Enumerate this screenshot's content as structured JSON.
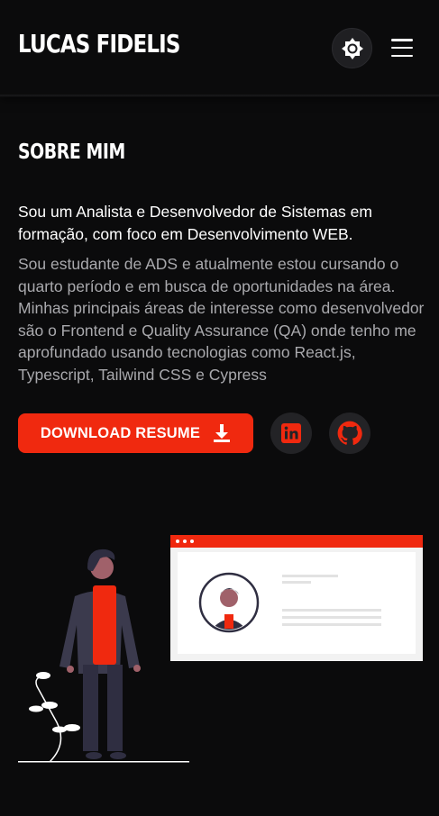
{
  "header": {
    "brand": "LUCAS FIDELIS",
    "theme_toggle_icon": "sun-gear-icon",
    "menu_icon": "hamburger-menu-icon"
  },
  "about": {
    "title": "SOBRE MIM",
    "lead": "Sou um Analista e Desenvolvedor de Sistemas em formação, com foco em Desenvolvimento WEB.",
    "description": "Sou estudante de ADS e atualmente estou cursando o quarto período e em busca de oportunidades na área. Minhas principais áreas de interesse como desenvolvedor são o Frontend e Quality Assurance (QA) onde tenho me aprofundado usando tecnologias como React.js, Typescript, Tailwind CSS e Cypress"
  },
  "actions": {
    "download_label": "DOWNLOAD RESUME",
    "download_icon": "download-icon",
    "linkedin_icon": "linkedin-icon",
    "github_icon": "github-icon"
  },
  "colors": {
    "accent": "#f0290f",
    "background": "#0b0b0c",
    "muted_text": "#a9a9ad"
  }
}
